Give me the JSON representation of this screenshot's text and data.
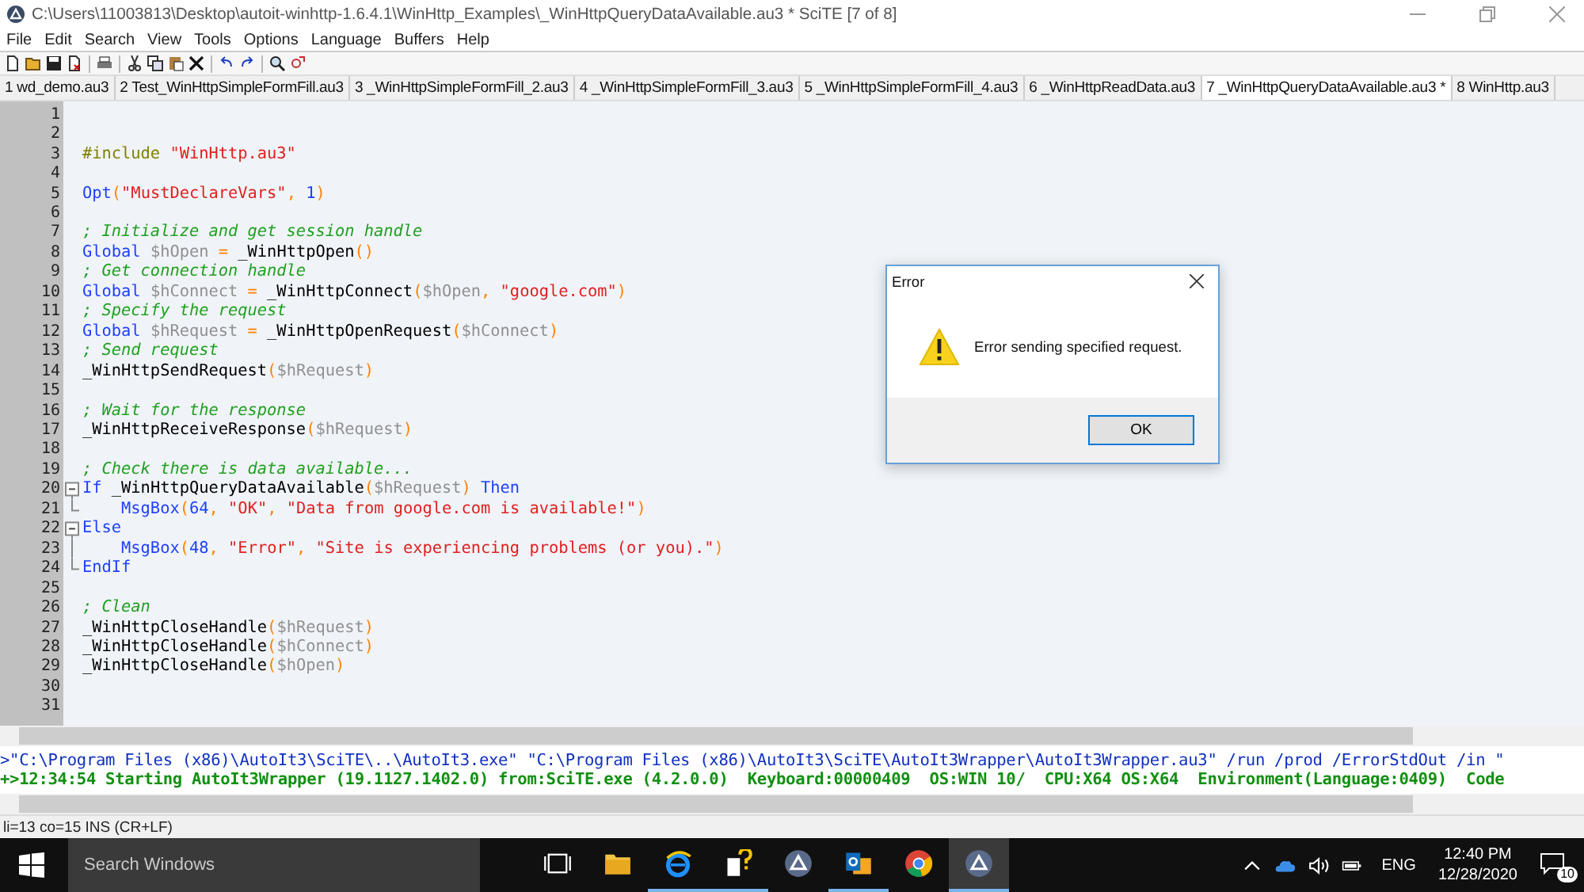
{
  "window": {
    "title": "C:\\Users\\11003813\\Desktop\\autoit-winhttp-1.6.4.1\\WinHttp_Examples\\_WinHttpQueryDataAvailable.au3 * SciTE [7 of 8]"
  },
  "menu": [
    "File",
    "Edit",
    "Search",
    "View",
    "Tools",
    "Options",
    "Language",
    "Buffers",
    "Help"
  ],
  "tabs": [
    {
      "label": "1 wd_demo.au3",
      "selected": false
    },
    {
      "label": "2 Test_WinHttpSimpleFormFill.au3",
      "selected": false
    },
    {
      "label": "3 _WinHttpSimpleFormFill_2.au3",
      "selected": false
    },
    {
      "label": "4 _WinHttpSimpleFormFill_3.au3",
      "selected": false
    },
    {
      "label": "5 _WinHttpSimpleFormFill_4.au3",
      "selected": false
    },
    {
      "label": "6 _WinHttpReadData.au3",
      "selected": false
    },
    {
      "label": "7 _WinHttpQueryDataAvailable.au3 *",
      "selected": true
    },
    {
      "label": "8 WinHttp.au3",
      "selected": false
    }
  ],
  "editor": {
    "lines": [
      {
        "num": "1"
      },
      {
        "num": "2"
      },
      {
        "num": "3",
        "tokens": [
          {
            "kind": "directive",
            "text": "#include "
          },
          {
            "kind": "string",
            "text": "\"WinHttp.au3\""
          }
        ]
      },
      {
        "num": "4"
      },
      {
        "num": "5",
        "tokens": [
          {
            "kind": "keyword",
            "text": "Opt"
          },
          {
            "kind": "op",
            "text": "("
          },
          {
            "kind": "string",
            "text": "\"MustDeclareVars\""
          },
          {
            "kind": "op",
            "text": ", "
          },
          {
            "kind": "number",
            "text": "1"
          },
          {
            "kind": "op",
            "text": ")"
          }
        ]
      },
      {
        "num": "6"
      },
      {
        "num": "7",
        "tokens": [
          {
            "kind": "comment",
            "text": "; Initialize and get session handle"
          }
        ]
      },
      {
        "num": "8",
        "tokens": [
          {
            "kind": "keyword",
            "text": "Global "
          },
          {
            "kind": "var",
            "text": "$hOpen"
          },
          {
            "kind": "op",
            "text": " = "
          },
          {
            "kind": "func",
            "text": "_WinHttpOpen"
          },
          {
            "kind": "op",
            "text": "()"
          }
        ]
      },
      {
        "num": "9",
        "tokens": [
          {
            "kind": "comment",
            "text": "; Get connection handle"
          }
        ]
      },
      {
        "num": "10",
        "tokens": [
          {
            "kind": "keyword",
            "text": "Global "
          },
          {
            "kind": "var",
            "text": "$hConnect"
          },
          {
            "kind": "op",
            "text": " = "
          },
          {
            "kind": "func",
            "text": "_WinHttpConnect"
          },
          {
            "kind": "op",
            "text": "("
          },
          {
            "kind": "var",
            "text": "$hOpen"
          },
          {
            "kind": "op",
            "text": ", "
          },
          {
            "kind": "string",
            "text": "\"google.com\""
          },
          {
            "kind": "op",
            "text": ")"
          }
        ]
      },
      {
        "num": "11",
        "tokens": [
          {
            "kind": "comment",
            "text": "; Specify the request"
          }
        ]
      },
      {
        "num": "12",
        "tokens": [
          {
            "kind": "keyword",
            "text": "Global "
          },
          {
            "kind": "var",
            "text": "$hRequest"
          },
          {
            "kind": "op",
            "text": " = "
          },
          {
            "kind": "func",
            "text": "_WinHttpOpenRequest"
          },
          {
            "kind": "op",
            "text": "("
          },
          {
            "kind": "var",
            "text": "$hConnect"
          },
          {
            "kind": "op",
            "text": ")"
          }
        ]
      },
      {
        "num": "13",
        "tokens": [
          {
            "kind": "comment",
            "text": "; Send request"
          }
        ]
      },
      {
        "num": "14",
        "tokens": [
          {
            "kind": "func",
            "text": "_WinHttpSendRequest"
          },
          {
            "kind": "op",
            "text": "("
          },
          {
            "kind": "var",
            "text": "$hRequest"
          },
          {
            "kind": "op",
            "text": ")"
          }
        ]
      },
      {
        "num": "15"
      },
      {
        "num": "16",
        "tokens": [
          {
            "kind": "comment",
            "text": "; Wait for the response"
          }
        ]
      },
      {
        "num": "17",
        "tokens": [
          {
            "kind": "func",
            "text": "_WinHttpReceiveResponse"
          },
          {
            "kind": "op",
            "text": "("
          },
          {
            "kind": "var",
            "text": "$hRequest"
          },
          {
            "kind": "op",
            "text": ")"
          }
        ]
      },
      {
        "num": "18"
      },
      {
        "num": "19",
        "tokens": [
          {
            "kind": "comment",
            "text": "; Check there is data available..."
          }
        ]
      },
      {
        "num": "20",
        "kind": "fold-start",
        "tokens": [
          {
            "kind": "keyword",
            "text": "If "
          },
          {
            "kind": "func",
            "text": "_WinHttpQueryDataAvailable"
          },
          {
            "kind": "op",
            "text": "("
          },
          {
            "kind": "var",
            "text": "$hRequest"
          },
          {
            "kind": "op",
            "text": ") "
          },
          {
            "kind": "keyword",
            "text": "Then"
          }
        ]
      },
      {
        "num": "21",
        "kind": "fold-end",
        "tokens": [
          {
            "kind": "keyword",
            "text": "    MsgBox"
          },
          {
            "kind": "op",
            "text": "("
          },
          {
            "kind": "number",
            "text": "64"
          },
          {
            "kind": "op",
            "text": ", "
          },
          {
            "kind": "string",
            "text": "\"OK\""
          },
          {
            "kind": "op",
            "text": ", "
          },
          {
            "kind": "string",
            "text": "\"Data from google.com is available!\""
          },
          {
            "kind": "op",
            "text": ")"
          }
        ]
      },
      {
        "num": "22",
        "kind": "fold-start",
        "tokens": [
          {
            "kind": "keyword",
            "text": "Else"
          }
        ]
      },
      {
        "num": "23",
        "kind": "fold-line",
        "tokens": [
          {
            "kind": "keyword",
            "text": "    MsgBox"
          },
          {
            "kind": "op",
            "text": "("
          },
          {
            "kind": "number",
            "text": "48"
          },
          {
            "kind": "op",
            "text": ", "
          },
          {
            "kind": "string",
            "text": "\"Error\""
          },
          {
            "kind": "op",
            "text": ", "
          },
          {
            "kind": "string",
            "text": "\"Site is experiencing problems (or you).\""
          },
          {
            "kind": "op",
            "text": ")"
          }
        ]
      },
      {
        "num": "24",
        "kind": "fold-end",
        "tokens": [
          {
            "kind": "keyword",
            "text": "EndIf"
          }
        ]
      },
      {
        "num": "25"
      },
      {
        "num": "26",
        "tokens": [
          {
            "kind": "comment",
            "text": "; Clean"
          }
        ]
      },
      {
        "num": "27",
        "tokens": [
          {
            "kind": "func",
            "text": "_WinHttpCloseHandle"
          },
          {
            "kind": "op",
            "text": "("
          },
          {
            "kind": "var",
            "text": "$hRequest"
          },
          {
            "kind": "op",
            "text": ")"
          }
        ]
      },
      {
        "num": "28",
        "tokens": [
          {
            "kind": "func",
            "text": "_WinHttpCloseHandle"
          },
          {
            "kind": "op",
            "text": "("
          },
          {
            "kind": "var",
            "text": "$hConnect"
          },
          {
            "kind": "op",
            "text": ")"
          }
        ]
      },
      {
        "num": "29",
        "tokens": [
          {
            "kind": "func",
            "text": "_WinHttpCloseHandle"
          },
          {
            "kind": "op",
            "text": "("
          },
          {
            "kind": "var",
            "text": "$hOpen"
          },
          {
            "kind": "op",
            "text": ")"
          }
        ]
      },
      {
        "num": "30"
      },
      {
        "num": "31"
      }
    ]
  },
  "output": [
    {
      "kind": "command",
      "text": ">\"C:\\Program Files (x86)\\AutoIt3\\SciTE\\..\\AutoIt3.exe\" \"C:\\Program Files (x86)\\AutoIt3\\SciTE\\AutoIt3Wrapper\\AutoIt3Wrapper.au3\" /run /prod /ErrorStdOut /in \""
    },
    {
      "kind": "info",
      "text": "+>12:34:54 Starting AutoIt3Wrapper (19.1127.1402.0) from:SciTE.exe (4.2.0.0)  Keyboard:00000409  OS:WIN 10/  CPU:X64 OS:X64  Environment(Language:0409)  Code"
    }
  ],
  "status_bar": "li=13 co=15 INS (CR+LF)",
  "dialog": {
    "title": "Error",
    "kind": "warning",
    "message": "Error sending specified request.",
    "button": "OK"
  },
  "taskbar": {
    "search": {
      "placeholder": "Search Windows"
    },
    "apps": [
      {
        "kind": "task-view",
        "running": false,
        "selected": false
      },
      {
        "kind": "folder",
        "running": false,
        "selected": false
      },
      {
        "kind": "browser",
        "running": true,
        "selected": false
      },
      {
        "kind": "help",
        "running": true,
        "selected": false
      },
      {
        "kind": "autoit",
        "running": false,
        "selected": false
      },
      {
        "kind": "mail",
        "running": true,
        "selected": false
      },
      {
        "kind": "chrome",
        "running": false,
        "selected": false
      },
      {
        "kind": "autoit",
        "running": true,
        "selected": true
      }
    ],
    "language": "ENG",
    "time": "12:40 PM",
    "date": "12/28/2020",
    "notifications": "10"
  }
}
